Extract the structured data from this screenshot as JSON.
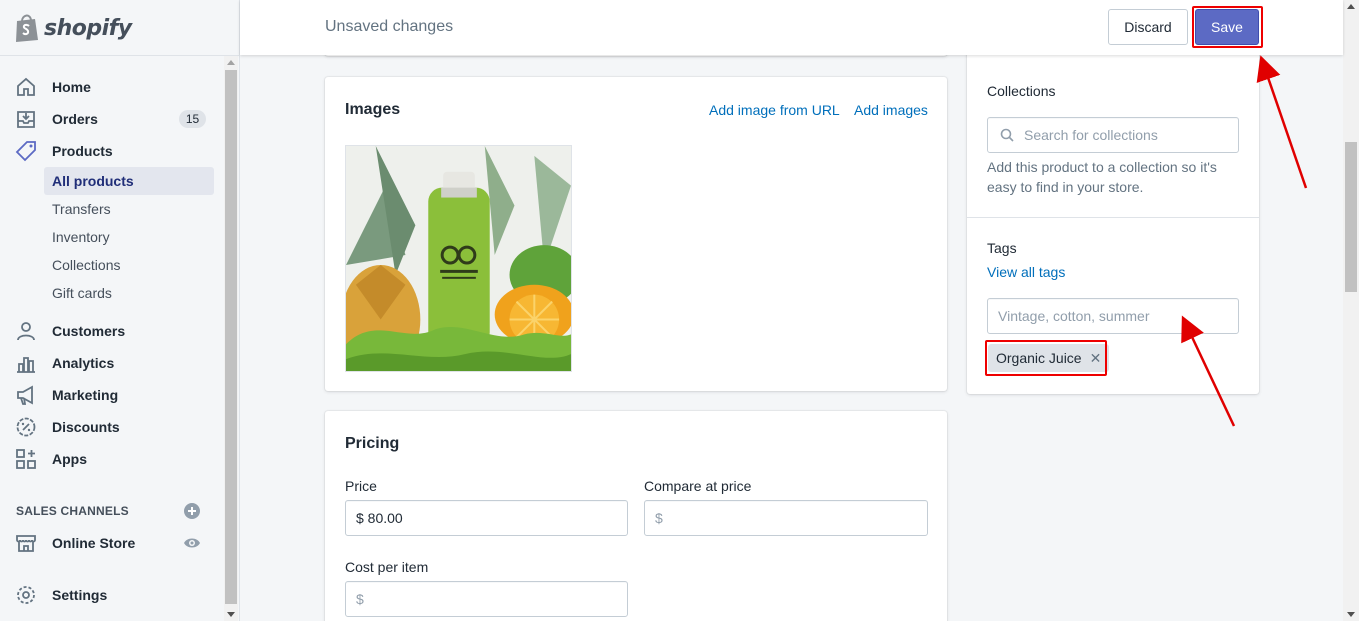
{
  "brand": {
    "name": "shopify"
  },
  "topbar": {
    "title": "Unsaved changes",
    "discard_label": "Discard",
    "save_label": "Save"
  },
  "sidebar": {
    "items": [
      {
        "label": "Home",
        "icon": "home-icon"
      },
      {
        "label": "Orders",
        "icon": "orders-icon",
        "badge": "15"
      },
      {
        "label": "Products",
        "icon": "tag-icon"
      }
    ],
    "product_subitems": [
      "All products",
      "Transfers",
      "Inventory",
      "Collections",
      "Gift cards"
    ],
    "items_after": [
      {
        "label": "Customers",
        "icon": "customers-icon"
      },
      {
        "label": "Analytics",
        "icon": "analytics-icon"
      },
      {
        "label": "Marketing",
        "icon": "marketing-icon"
      },
      {
        "label": "Discounts",
        "icon": "discount-icon"
      },
      {
        "label": "Apps",
        "icon": "apps-icon"
      }
    ],
    "sales_channels_title": "SALES CHANNELS",
    "online_store_label": "Online Store",
    "settings_label": "Settings"
  },
  "images_card": {
    "title": "Images",
    "add_from_url": "Add image from URL",
    "add_images": "Add images"
  },
  "pricing": {
    "title": "Pricing",
    "price_label": "Price",
    "price_value": "$ 80.00",
    "compare_label": "Compare at price",
    "compare_placeholder": "$",
    "cost_label": "Cost per item",
    "cost_placeholder": "$"
  },
  "organization": {
    "collections_label": "Collections",
    "collections_placeholder": "Search for collections",
    "collections_help": "Add this product to a collection so it's easy to find in your store.",
    "tags_label": "Tags",
    "view_all_tags": "View all tags",
    "tags_placeholder": "Vintage, cotton, summer",
    "tags": [
      "Organic Juice"
    ]
  },
  "colors": {
    "accent": "#5c6ac4",
    "link": "#006fbb",
    "annotation": "#e00000"
  }
}
